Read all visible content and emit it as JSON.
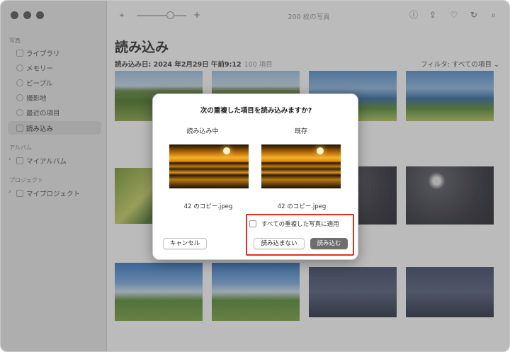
{
  "window": {
    "photo_count": "200 枚の写真"
  },
  "sidebar": {
    "section_photos": "写真",
    "items": [
      {
        "label": "ライブラリ",
        "icon": "photo-library-icon"
      },
      {
        "label": "メモリー",
        "icon": "memories-icon"
      },
      {
        "label": "ピープル",
        "icon": "people-icon"
      },
      {
        "label": "撮影地",
        "icon": "places-icon"
      },
      {
        "label": "最近の項目",
        "icon": "recents-icon"
      },
      {
        "label": "読み込み",
        "icon": "imports-icon",
        "active": true
      }
    ],
    "section_albums": "アルバム",
    "albums_item": "マイアルバム",
    "section_projects": "プロジェクト",
    "projects_item": "マイプロジェクト"
  },
  "main": {
    "title": "読み込み",
    "import_date": "読み込み日: 2024 年2月29日 午前9:12",
    "item_count": "100 項目",
    "filter": "フィルタ: すべての項目"
  },
  "dialog": {
    "title": "次の重複した項目を読み込みますか?",
    "col_importing": "読み込み中",
    "col_existing": "既存",
    "file_importing": "42 のコピー.jpeg",
    "file_existing": "42 のコピー.jpeg",
    "apply_all": "すべての重複した写真に適用",
    "cancel": "キャンセル",
    "dont_import": "読み込まない",
    "import": "読み込む"
  },
  "colors": {
    "highlight": "#e0321f",
    "primary_button": "#6e6e6e"
  }
}
